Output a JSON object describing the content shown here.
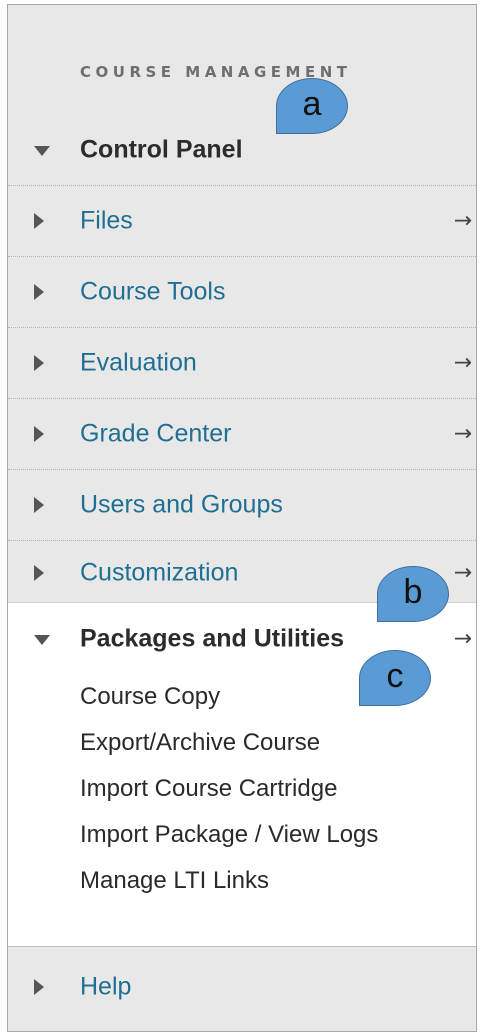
{
  "sidebar": {
    "heading": "COURSE MANAGEMENT",
    "items": [
      {
        "label": "Control Panel",
        "expanded": true,
        "arrow": ""
      },
      {
        "label": "Files",
        "expanded": false,
        "arrow": "→"
      },
      {
        "label": "Course Tools",
        "expanded": false,
        "arrow": ""
      },
      {
        "label": "Evaluation",
        "expanded": false,
        "arrow": "→"
      },
      {
        "label": "Grade Center",
        "expanded": false,
        "arrow": "→"
      },
      {
        "label": "Users and Groups",
        "expanded": false,
        "arrow": ""
      },
      {
        "label": "Customization",
        "expanded": false,
        "arrow": "→"
      },
      {
        "label": "Packages and Utilities",
        "expanded": true,
        "arrow": "→"
      },
      {
        "label": "Help",
        "expanded": false,
        "arrow": ""
      }
    ],
    "packages_subitems": [
      "Course Copy",
      "Export/Archive Course",
      "Import Course Cartridge",
      "Import Package / View Logs",
      "Manage LTI Links"
    ]
  },
  "callouts": {
    "a": "a",
    "b": "b",
    "c": "c"
  },
  "colors": {
    "link": "#1f6f93",
    "panel_bg": "#e8e8e8",
    "callout": "#5b9bd5"
  }
}
